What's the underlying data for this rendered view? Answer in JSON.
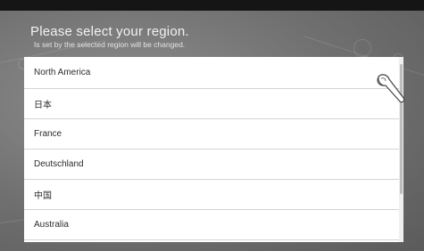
{
  "header": {
    "title": "Please select your region.",
    "subtitle": "Is set by the selected region will be changed."
  },
  "regions": [
    {
      "label": "North America"
    },
    {
      "label": "日本"
    },
    {
      "label": "France"
    },
    {
      "label": "Deutschland"
    },
    {
      "label": "中国"
    },
    {
      "label": "Australia"
    }
  ],
  "icons": {
    "pointer": "finger-tap-icon"
  },
  "colors": {
    "list_background": "#ffffff",
    "screen_background": "#7a7a7a",
    "text": "#2c2c2c"
  }
}
